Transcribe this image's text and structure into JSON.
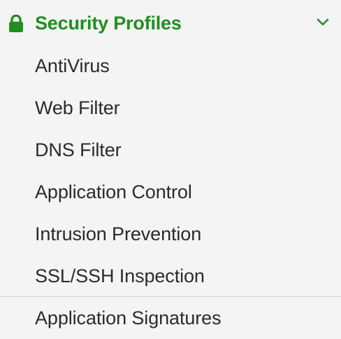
{
  "security_profiles": {
    "title": "Security Profiles",
    "expanded": true,
    "accent_color": "#1f8f1f",
    "icons": {
      "section": "lock-icon",
      "toggle": "chevron-down-icon"
    },
    "items": [
      {
        "label": "AntiVirus"
      },
      {
        "label": "Web Filter"
      },
      {
        "label": "DNS Filter"
      },
      {
        "label": "Application Control"
      },
      {
        "label": "Intrusion Prevention"
      },
      {
        "label": "SSL/SSH Inspection"
      },
      {
        "label": "Application Signatures"
      }
    ]
  }
}
